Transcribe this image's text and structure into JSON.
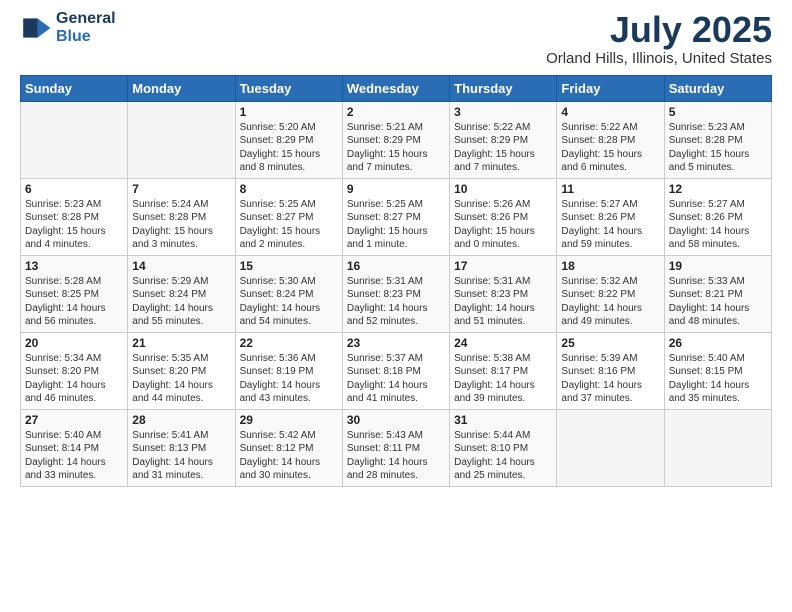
{
  "header": {
    "logo_line1": "General",
    "logo_line2": "Blue",
    "month_year": "July 2025",
    "location": "Orland Hills, Illinois, United States"
  },
  "days_of_week": [
    "Sunday",
    "Monday",
    "Tuesday",
    "Wednesday",
    "Thursday",
    "Friday",
    "Saturday"
  ],
  "weeks": [
    [
      {
        "day": "",
        "info": ""
      },
      {
        "day": "",
        "info": ""
      },
      {
        "day": "1",
        "info": "Sunrise: 5:20 AM\nSunset: 8:29 PM\nDaylight: 15 hours\nand 8 minutes."
      },
      {
        "day": "2",
        "info": "Sunrise: 5:21 AM\nSunset: 8:29 PM\nDaylight: 15 hours\nand 7 minutes."
      },
      {
        "day": "3",
        "info": "Sunrise: 5:22 AM\nSunset: 8:29 PM\nDaylight: 15 hours\nand 7 minutes."
      },
      {
        "day": "4",
        "info": "Sunrise: 5:22 AM\nSunset: 8:28 PM\nDaylight: 15 hours\nand 6 minutes."
      },
      {
        "day": "5",
        "info": "Sunrise: 5:23 AM\nSunset: 8:28 PM\nDaylight: 15 hours\nand 5 minutes."
      }
    ],
    [
      {
        "day": "6",
        "info": "Sunrise: 5:23 AM\nSunset: 8:28 PM\nDaylight: 15 hours\nand 4 minutes."
      },
      {
        "day": "7",
        "info": "Sunrise: 5:24 AM\nSunset: 8:28 PM\nDaylight: 15 hours\nand 3 minutes."
      },
      {
        "day": "8",
        "info": "Sunrise: 5:25 AM\nSunset: 8:27 PM\nDaylight: 15 hours\nand 2 minutes."
      },
      {
        "day": "9",
        "info": "Sunrise: 5:25 AM\nSunset: 8:27 PM\nDaylight: 15 hours\nand 1 minute."
      },
      {
        "day": "10",
        "info": "Sunrise: 5:26 AM\nSunset: 8:26 PM\nDaylight: 15 hours\nand 0 minutes."
      },
      {
        "day": "11",
        "info": "Sunrise: 5:27 AM\nSunset: 8:26 PM\nDaylight: 14 hours\nand 59 minutes."
      },
      {
        "day": "12",
        "info": "Sunrise: 5:27 AM\nSunset: 8:26 PM\nDaylight: 14 hours\nand 58 minutes."
      }
    ],
    [
      {
        "day": "13",
        "info": "Sunrise: 5:28 AM\nSunset: 8:25 PM\nDaylight: 14 hours\nand 56 minutes."
      },
      {
        "day": "14",
        "info": "Sunrise: 5:29 AM\nSunset: 8:24 PM\nDaylight: 14 hours\nand 55 minutes."
      },
      {
        "day": "15",
        "info": "Sunrise: 5:30 AM\nSunset: 8:24 PM\nDaylight: 14 hours\nand 54 minutes."
      },
      {
        "day": "16",
        "info": "Sunrise: 5:31 AM\nSunset: 8:23 PM\nDaylight: 14 hours\nand 52 minutes."
      },
      {
        "day": "17",
        "info": "Sunrise: 5:31 AM\nSunset: 8:23 PM\nDaylight: 14 hours\nand 51 minutes."
      },
      {
        "day": "18",
        "info": "Sunrise: 5:32 AM\nSunset: 8:22 PM\nDaylight: 14 hours\nand 49 minutes."
      },
      {
        "day": "19",
        "info": "Sunrise: 5:33 AM\nSunset: 8:21 PM\nDaylight: 14 hours\nand 48 minutes."
      }
    ],
    [
      {
        "day": "20",
        "info": "Sunrise: 5:34 AM\nSunset: 8:20 PM\nDaylight: 14 hours\nand 46 minutes."
      },
      {
        "day": "21",
        "info": "Sunrise: 5:35 AM\nSunset: 8:20 PM\nDaylight: 14 hours\nand 44 minutes."
      },
      {
        "day": "22",
        "info": "Sunrise: 5:36 AM\nSunset: 8:19 PM\nDaylight: 14 hours\nand 43 minutes."
      },
      {
        "day": "23",
        "info": "Sunrise: 5:37 AM\nSunset: 8:18 PM\nDaylight: 14 hours\nand 41 minutes."
      },
      {
        "day": "24",
        "info": "Sunrise: 5:38 AM\nSunset: 8:17 PM\nDaylight: 14 hours\nand 39 minutes."
      },
      {
        "day": "25",
        "info": "Sunrise: 5:39 AM\nSunset: 8:16 PM\nDaylight: 14 hours\nand 37 minutes."
      },
      {
        "day": "26",
        "info": "Sunrise: 5:40 AM\nSunset: 8:15 PM\nDaylight: 14 hours\nand 35 minutes."
      }
    ],
    [
      {
        "day": "27",
        "info": "Sunrise: 5:40 AM\nSunset: 8:14 PM\nDaylight: 14 hours\nand 33 minutes."
      },
      {
        "day": "28",
        "info": "Sunrise: 5:41 AM\nSunset: 8:13 PM\nDaylight: 14 hours\nand 31 minutes."
      },
      {
        "day": "29",
        "info": "Sunrise: 5:42 AM\nSunset: 8:12 PM\nDaylight: 14 hours\nand 30 minutes."
      },
      {
        "day": "30",
        "info": "Sunrise: 5:43 AM\nSunset: 8:11 PM\nDaylight: 14 hours\nand 28 minutes."
      },
      {
        "day": "31",
        "info": "Sunrise: 5:44 AM\nSunset: 8:10 PM\nDaylight: 14 hours\nand 25 minutes."
      },
      {
        "day": "",
        "info": ""
      },
      {
        "day": "",
        "info": ""
      }
    ]
  ]
}
